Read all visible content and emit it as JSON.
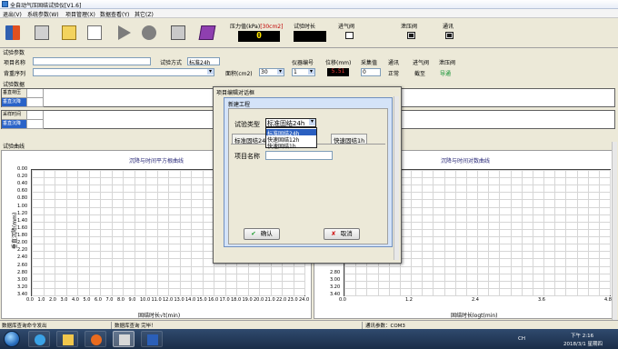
{
  "app": {
    "title": "全自动气压固结试验仪[V1.6]"
  },
  "menu": [
    "退出(V)",
    "系统参数(W)",
    "项目管理(X)",
    "数据查看(Y)",
    "其它(Z)"
  ],
  "toolbar": {
    "icons": [
      "exit-icon",
      "params-icon",
      "folder-icon",
      "document-icon",
      "play-icon",
      "stop-icon",
      "clear-icon",
      "book-icon"
    ],
    "pressure_label": "压力值(kPa)",
    "pressure_unit": "[30cm2]",
    "pressure_value": "0",
    "test_time_label": "试验时长",
    "inlet_label": "进气阀",
    "outlet_label": "泄压阀",
    "comm_label": "通讯"
  },
  "params": {
    "section_title": "试验参数",
    "project_name_label": "项目名称",
    "project_name_value": "",
    "test_method_label": "试验方式",
    "test_method_value": "标准24h",
    "soil_seq_label": "背重序列",
    "soil_seq_value": "",
    "area_label": "面积(cm2)",
    "area_value": "30",
    "instrument_no_label": "仪器编号",
    "instrument_no_value": "1",
    "displacement_label": "位移(mm)",
    "displacement_value": "5.51",
    "sample_interval_label": "采集值",
    "sample_interval_value": "0",
    "comm_label": "通讯",
    "comm_value": "正常",
    "inlet_label": "进气阀",
    "inlet_value": "截至",
    "outlet_label": "泄压阀",
    "outlet_value": "导通"
  },
  "data": {
    "section_title": "试验数据",
    "rows_top": [
      "垂直荷压",
      "垂直沉降"
    ],
    "rows_bottom": [
      "采样时间",
      "垂直沉降"
    ]
  },
  "curves": {
    "section_title": "试验曲线",
    "left": {
      "title": "沉降与时间平方根曲线",
      "ylabel": "垂直沉降(mm)",
      "xlabel": "固结时长√t(min)",
      "y_ticks": [
        "0.00",
        "0.20",
        "0.40",
        "0.60",
        "0.80",
        "1.00",
        "1.20",
        "1.40",
        "1.60",
        "1.80",
        "2.00",
        "2.20",
        "2.40",
        "2.60",
        "2.80",
        "3.00",
        "3.20",
        "3.40"
      ],
      "x_ticks": [
        "0.0",
        "1.0",
        "2.0",
        "3.0",
        "4.0",
        "5.0",
        "6.0",
        "7.0",
        "8.0",
        "9.0",
        "10.0",
        "11.0",
        "12.0",
        "13.0",
        "14.0",
        "15.0",
        "16.0",
        "17.0",
        "18.0",
        "19.0",
        "20.0",
        "21.0",
        "22.0",
        "23.0",
        "24.0"
      ]
    },
    "right": {
      "title": "沉降与时间对数曲线",
      "xlabel": "固结时长logt(min)",
      "y_ticks_visible": [
        "2.80",
        "3.00",
        "3.20",
        "3.40"
      ],
      "x_ticks": [
        "0.0",
        "1.2",
        "2.4",
        "3.6",
        "4.8"
      ]
    }
  },
  "status": {
    "left": "数据库查询命令发出",
    "mid": "数据库查询 完毕！",
    "right": "通讯参数：COM3"
  },
  "taskbar": {
    "items": [
      "ie-icon",
      "explorer-icon",
      "media-icon",
      "app-icon",
      "word-icon"
    ],
    "tray_lang": "CH",
    "time": "下午 2:16",
    "date": "2018/3/1 星期四"
  },
  "dialog_outer": {
    "title": "项目编辑对话框"
  },
  "dialog_inner": {
    "title": "新建工程",
    "test_type_label": "试验类型",
    "test_type_value": "标准固结24h",
    "dropdown_options": [
      "标准固结24h",
      "快速固结12h",
      "快速固结1h"
    ],
    "tabs": [
      "标准固结24h",
      "快速固结1h"
    ],
    "project_name_label": "项目名称",
    "project_name_value": "",
    "ok_label": "确认",
    "cancel_label": "取消"
  }
}
